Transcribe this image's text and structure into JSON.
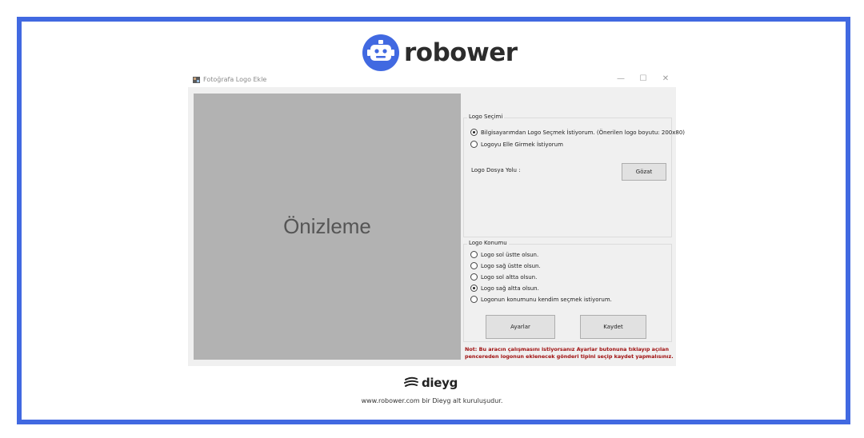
{
  "brand": {
    "name": "robower"
  },
  "window": {
    "title": "Fotoğrafa Logo Ekle",
    "controls": {
      "minimize": "—",
      "maximize": "☐",
      "close": "✕"
    },
    "preview_label": "Önizleme",
    "logo_selection": {
      "title": "Logo Seçimi",
      "options": [
        {
          "label": "Bilgisayarımdan Logo Seçmek İstiyorum.  (Önerilen logo boyutu: 200x80)",
          "checked": true
        },
        {
          "label": "Logoyu Elle Girmek İstiyorum",
          "checked": false
        }
      ],
      "path_label": "Logo Dosya Yolu :",
      "browse_button": "Gözat"
    },
    "logo_position": {
      "title": "Logo Konumu",
      "options": [
        {
          "label": "Logo sol üstte olsun.",
          "checked": false
        },
        {
          "label": "Logo sağ üstte olsun.",
          "checked": false
        },
        {
          "label": "Logo sol altta olsun.",
          "checked": false
        },
        {
          "label": "Logo sağ altta olsun.",
          "checked": true
        },
        {
          "label": "Logonun konumunu kendim seçmek istiyorum.",
          "checked": false
        }
      ]
    },
    "buttons": {
      "settings": "Ayarlar",
      "save": "Kaydet"
    },
    "note": "Not: Bu aracın çalışmasını istiyorsanız Ayarlar butonuna tıklayıp açılan pencereden logonun eklenecek gönderi tipini seçip kaydet yapmalısınız."
  },
  "footer": {
    "brand": "dieyg",
    "text": "www.robower.com bir Dieyg alt kuruluşudur."
  },
  "colors": {
    "frame": "#4169e1",
    "note": "#a01010"
  }
}
